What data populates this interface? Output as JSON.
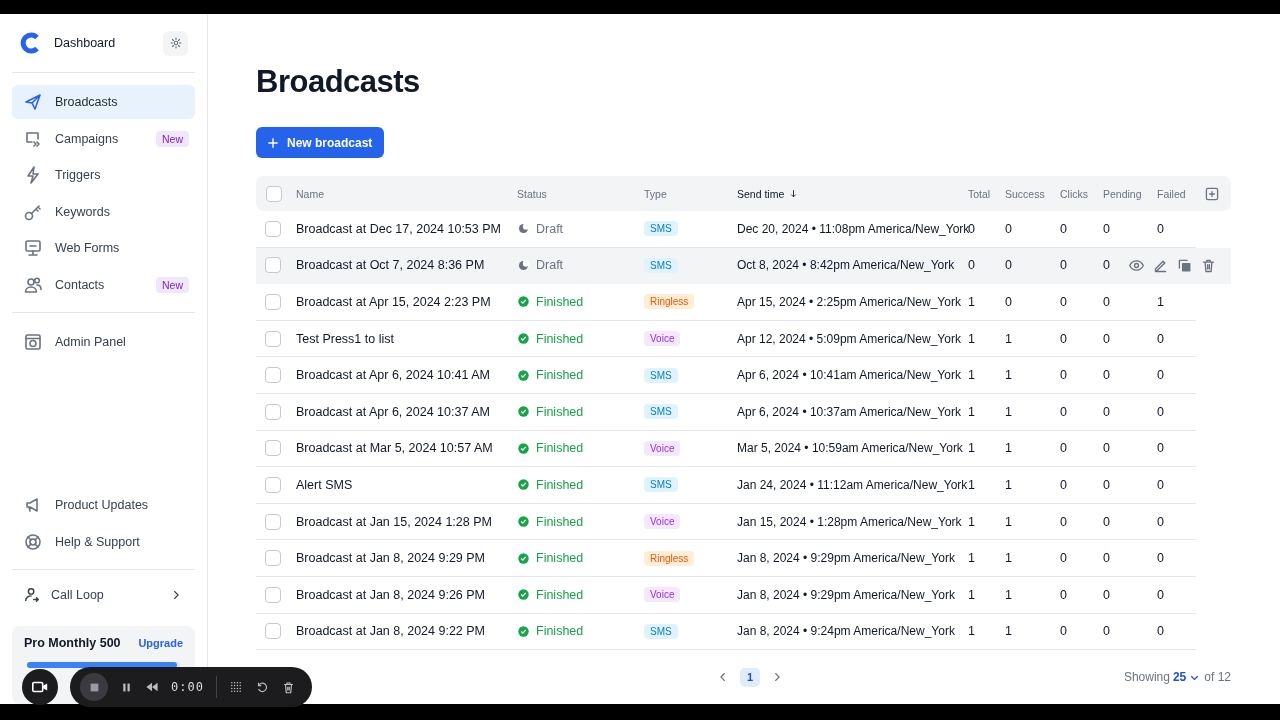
{
  "sidebar": {
    "brand": "Dashboard",
    "nav": [
      {
        "label": "Broadcasts",
        "selected": true
      },
      {
        "label": "Campaigns",
        "selected": false,
        "badge": "New"
      },
      {
        "label": "Triggers",
        "selected": false
      },
      {
        "label": "Keywords",
        "selected": false
      },
      {
        "label": "Web Forms",
        "selected": false
      },
      {
        "label": "Contacts",
        "selected": false,
        "badge": "New"
      }
    ],
    "admin": [
      {
        "label": "Admin Panel",
        "selected": false
      }
    ],
    "footer": [
      {
        "label": "Product Updates"
      },
      {
        "label": "Help & Support"
      }
    ],
    "account": {
      "label": "Call Loop"
    },
    "plan": {
      "name": "Pro Monthly 500",
      "action": "Upgrade",
      "level": 0.98
    }
  },
  "page": {
    "title": "Broadcasts",
    "new_button": "New broadcast"
  },
  "table": {
    "header_checked": false,
    "columns": [
      {
        "label": "Name",
        "sorted": false
      },
      {
        "label": "Status",
        "sorted": false
      },
      {
        "label": "Type",
        "sorted": false
      },
      {
        "label": "Send time",
        "sorted": true
      },
      {
        "label": "Total",
        "sorted": false
      },
      {
        "label": "Success",
        "sorted": false
      },
      {
        "label": "Clicks",
        "sorted": false
      },
      {
        "label": "Pending",
        "sorted": false
      },
      {
        "label": "Failed",
        "sorted": false
      }
    ],
    "rows": [
      {
        "checked": false,
        "hovered": false,
        "name": "Broadcast at Dec 17, 2024 10:53 PM",
        "status": {
          "kind": "draft",
          "label": "Draft"
        },
        "type": {
          "kind": "sms",
          "label": "SMS"
        },
        "send_time": "Dec 20, 2024 • 11:08pm America/New_York",
        "total": "0",
        "success": "0",
        "clicks": "0",
        "pending": "0",
        "failed": "0"
      },
      {
        "checked": false,
        "hovered": true,
        "name": "Broadcast at Oct 7, 2024 8:36 PM",
        "status": {
          "kind": "draft",
          "label": "Draft"
        },
        "type": {
          "kind": "sms",
          "label": "SMS"
        },
        "send_time": "Oct 8, 2024 • 8:42pm America/New_York",
        "total": "0",
        "success": "0",
        "clicks": "0",
        "pending": "0"
      },
      {
        "checked": false,
        "hovered": false,
        "name": "Broadcast at Apr 15, 2024 2:23 PM",
        "status": {
          "kind": "finished",
          "label": "Finished"
        },
        "type": {
          "kind": "ringless",
          "label": "Ringless"
        },
        "send_time": "Apr 15, 2024 • 2:25pm America/New_York",
        "total": "1",
        "success": "0",
        "clicks": "0",
        "pending": "0",
        "failed": "1"
      },
      {
        "checked": false,
        "hovered": false,
        "name": "Test Press1 to list",
        "status": {
          "kind": "finished",
          "label": "Finished"
        },
        "type": {
          "kind": "voice",
          "label": "Voice"
        },
        "send_time": "Apr 12, 2024 • 5:09pm America/New_York",
        "total": "1",
        "success": "1",
        "clicks": "0",
        "pending": "0",
        "failed": "0"
      },
      {
        "checked": false,
        "hovered": false,
        "name": "Broadcast at Apr 6, 2024 10:41 AM",
        "status": {
          "kind": "finished",
          "label": "Finished"
        },
        "type": {
          "kind": "sms",
          "label": "SMS"
        },
        "send_time": "Apr 6, 2024 • 10:41am America/New_York",
        "total": "1",
        "success": "1",
        "clicks": "0",
        "pending": "0",
        "failed": "0"
      },
      {
        "checked": false,
        "hovered": false,
        "name": "Broadcast at Apr 6, 2024 10:37 AM",
        "status": {
          "kind": "finished",
          "label": "Finished"
        },
        "type": {
          "kind": "sms",
          "label": "SMS"
        },
        "send_time": "Apr 6, 2024 • 10:37am America/New_York",
        "total": "1",
        "success": "1",
        "clicks": "0",
        "pending": "0",
        "failed": "0"
      },
      {
        "checked": false,
        "hovered": false,
        "name": "Broadcast at Mar 5, 2024 10:57 AM",
        "status": {
          "kind": "finished",
          "label": "Finished"
        },
        "type": {
          "kind": "voice",
          "label": "Voice"
        },
        "send_time": "Mar 5, 2024 • 10:59am America/New_York",
        "total": "1",
        "success": "1",
        "clicks": "0",
        "pending": "0",
        "failed": "0"
      },
      {
        "checked": false,
        "hovered": false,
        "name": "Alert SMS",
        "status": {
          "kind": "finished",
          "label": "Finished"
        },
        "type": {
          "kind": "sms",
          "label": "SMS"
        },
        "send_time": "Jan 24, 2024 • 11:12am America/New_York",
        "total": "1",
        "success": "1",
        "clicks": "0",
        "pending": "0",
        "failed": "0"
      },
      {
        "checked": false,
        "hovered": false,
        "name": "Broadcast at Jan 15, 2024 1:28 PM",
        "status": {
          "kind": "finished",
          "label": "Finished"
        },
        "type": {
          "kind": "voice",
          "label": "Voice"
        },
        "send_time": "Jan 15, 2024 • 1:28pm America/New_York",
        "total": "1",
        "success": "1",
        "clicks": "0",
        "pending": "0",
        "failed": "0"
      },
      {
        "checked": false,
        "hovered": false,
        "name": "Broadcast at Jan 8, 2024 9:29 PM",
        "status": {
          "kind": "finished",
          "label": "Finished"
        },
        "type": {
          "kind": "ringless",
          "label": "Ringless"
        },
        "send_time": "Jan 8, 2024 • 9:29pm America/New_York",
        "total": "1",
        "success": "1",
        "clicks": "0",
        "pending": "0",
        "failed": "0"
      },
      {
        "checked": false,
        "hovered": false,
        "name": "Broadcast at Jan 8, 2024 9:26 PM",
        "status": {
          "kind": "finished",
          "label": "Finished"
        },
        "type": {
          "kind": "voice",
          "label": "Voice"
        },
        "send_time": "Jan 8, 2024 • 9:29pm America/New_York",
        "total": "1",
        "success": "1",
        "clicks": "0",
        "pending": "0",
        "failed": "0"
      },
      {
        "checked": false,
        "hovered": false,
        "name": "Broadcast at Jan 8, 2024 9:22 PM",
        "status": {
          "kind": "finished",
          "label": "Finished"
        },
        "type": {
          "kind": "sms",
          "label": "SMS"
        },
        "send_time": "Jan 8, 2024 • 9:24pm America/New_York",
        "total": "1",
        "success": "1",
        "clicks": "0",
        "pending": "0",
        "failed": "0"
      }
    ]
  },
  "pagination": {
    "pages": [
      {
        "label": "1",
        "selected": true
      }
    ],
    "showing": "Showing",
    "page_size": "25",
    "of_total": "of 12"
  },
  "recorder": {
    "time": "0:00"
  }
}
